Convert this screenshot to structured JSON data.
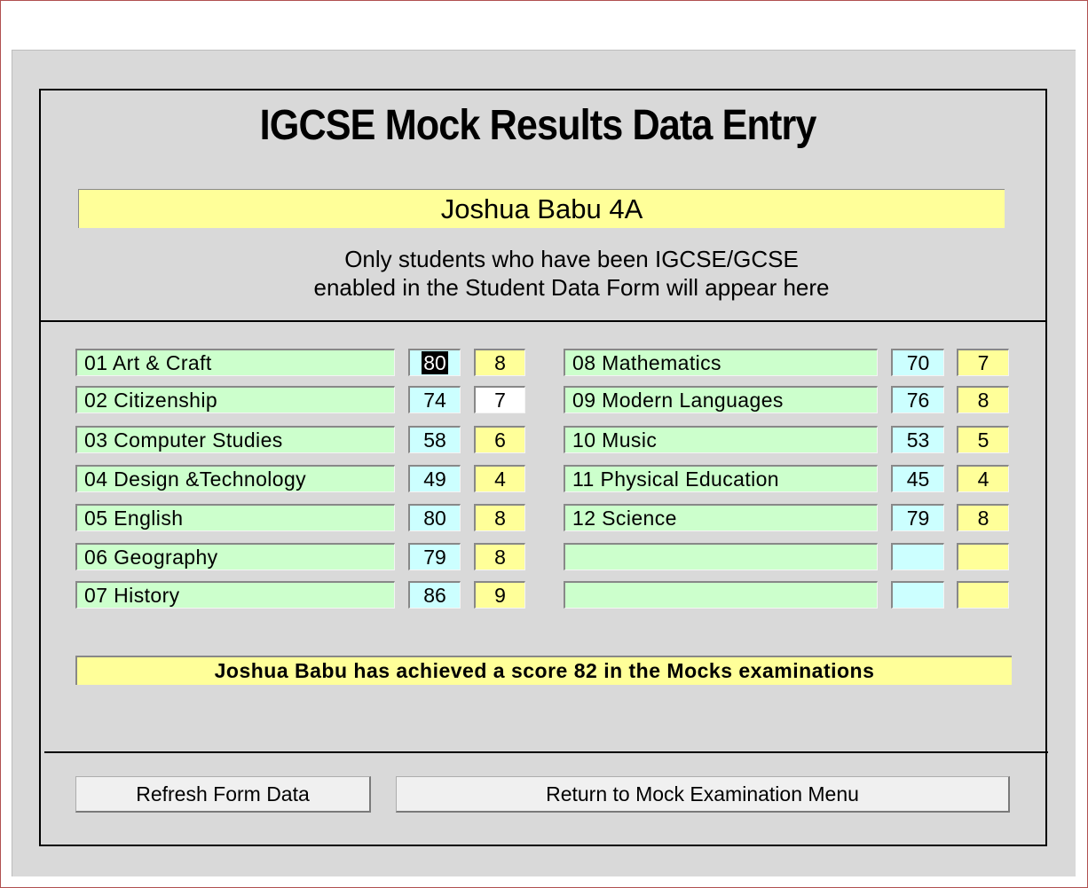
{
  "title": "IGCSE Mock Results Data Entry",
  "student_name": "Joshua Babu 4A",
  "note_line1": "Only students who have been IGCSE/GCSE",
  "note_line2": "enabled in the Student Data Form will appear here",
  "subjects_left": [
    {
      "name": "01 Art & Craft",
      "mark": "80",
      "grade": "8"
    },
    {
      "name": "02 Citizenship",
      "mark": "74",
      "grade": "7"
    },
    {
      "name": "03 Computer Studies",
      "mark": "58",
      "grade": "6"
    },
    {
      "name": "04 Design &Technology",
      "mark": "49",
      "grade": "4"
    },
    {
      "name": "05 English",
      "mark": "80",
      "grade": "8"
    },
    {
      "name": "06 Geography",
      "mark": "79",
      "grade": "8"
    },
    {
      "name": "07 History",
      "mark": "86",
      "grade": "9"
    }
  ],
  "subjects_right": [
    {
      "name": "08 Mathematics",
      "mark": "70",
      "grade": "7"
    },
    {
      "name": "09 Modern Languages",
      "mark": "76",
      "grade": "8"
    },
    {
      "name": "10 Music",
      "mark": "53",
      "grade": "5"
    },
    {
      "name": "11 Physical Education",
      "mark": "45",
      "grade": "4"
    },
    {
      "name": "12 Science",
      "mark": "79",
      "grade": "8"
    },
    {
      "name": "",
      "mark": "",
      "grade": ""
    },
    {
      "name": "",
      "mark": "",
      "grade": ""
    }
  ],
  "summary": "Joshua Babu has achieved a score 82 in the Mocks examinations",
  "buttons": {
    "refresh": "Refresh Form Data",
    "return": "Return to Mock Examination Menu"
  },
  "colors": {
    "subject_bg": "#ccffcc",
    "mark_bg": "#ccffff",
    "grade_bg": "#ffff99",
    "form_bg": "#d9d9d9"
  }
}
